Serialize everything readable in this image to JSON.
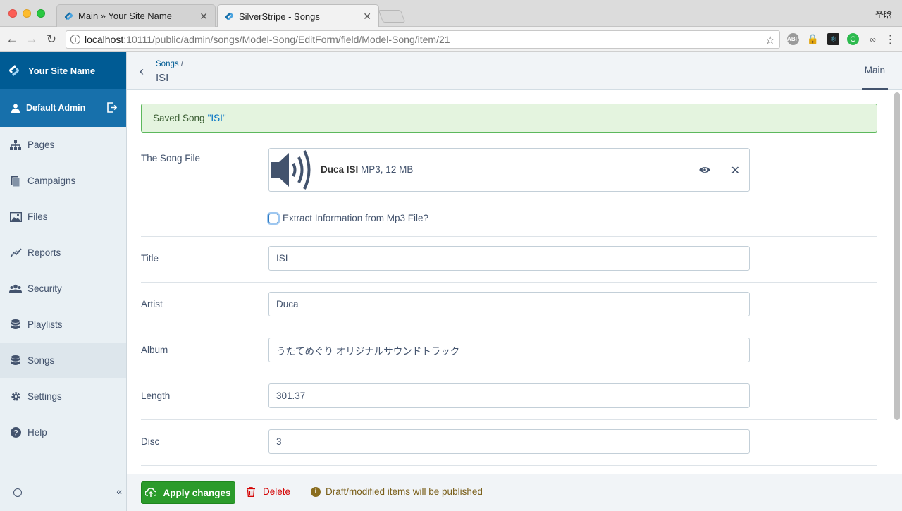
{
  "browser": {
    "tabs": [
      {
        "title": "Main » Your Site Name",
        "active": false
      },
      {
        "title": "SilverStripe - Songs",
        "active": true
      }
    ],
    "user_chip": "圣晗",
    "url_host": "localhost",
    "url_path": ":10111/public/admin/songs/Model-Song/EditForm/field/Model-Song/item/21",
    "extensions": [
      "ABP",
      "lock",
      "react",
      "grammarly",
      "chain"
    ]
  },
  "sidebar": {
    "site_name": "Your Site Name",
    "user_name": "Default Admin",
    "items": [
      {
        "label": "Pages",
        "icon": "sitemap-icon"
      },
      {
        "label": "Campaigns",
        "icon": "campaigns-icon"
      },
      {
        "label": "Files",
        "icon": "image-icon"
      },
      {
        "label": "Reports",
        "icon": "chart-line-icon"
      },
      {
        "label": "Security",
        "icon": "users-icon"
      },
      {
        "label": "Playlists",
        "icon": "database-icon"
      },
      {
        "label": "Songs",
        "icon": "database-icon",
        "active": true
      },
      {
        "label": "Settings",
        "icon": "gear-icon"
      },
      {
        "label": "Help",
        "icon": "help-icon"
      }
    ],
    "collapse_label": "«"
  },
  "header": {
    "breadcrumb_parent": "Songs",
    "breadcrumb_sep": "/",
    "title": "ISI",
    "tab_main": "Main"
  },
  "form": {
    "alert_prefix": "Saved Song",
    "alert_link": "\"ISI\"",
    "song_file_label": "The Song File",
    "file_name": "Duca ISI",
    "file_meta": "MP3, 12 MB",
    "extract_label": "Extract Information from Mp3 File?",
    "fields": {
      "title": {
        "label": "Title",
        "value": "ISI"
      },
      "artist": {
        "label": "Artist",
        "value": "Duca"
      },
      "album": {
        "label": "Album",
        "value": "うたてめぐり オリジナルサウンドトラック"
      },
      "length": {
        "label": "Length",
        "value": "301.37"
      },
      "disc": {
        "label": "Disc",
        "value": "3"
      }
    }
  },
  "actions": {
    "apply": "Apply changes",
    "delete": "Delete",
    "notice": "Draft/modified items will be published"
  },
  "colors": {
    "brand": "#005b94",
    "user_bar": "#1770ab",
    "success": "#2b9b2b",
    "danger": "#d40404"
  }
}
